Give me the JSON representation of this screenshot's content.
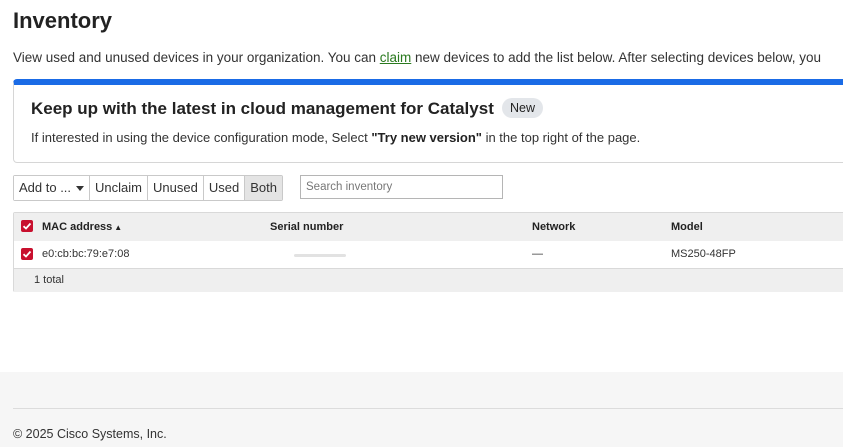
{
  "page": {
    "title": "Inventory",
    "intro_before": "View used and unused devices in your organization. You can ",
    "intro_link": "claim",
    "intro_after": " new devices to add the list below. After selecting devices below, you"
  },
  "banner": {
    "title": "Keep up with the latest in cloud management for Catalyst",
    "badge": "New",
    "text_before": "If interested in using the device configuration mode, Select ",
    "text_bold": "\"Try new version\"",
    "text_after": " in the top right of the page.",
    "accent_color": "#1a6be6"
  },
  "toolbar": {
    "add_to_label": "Add to ...",
    "unclaim_label": "Unclaim",
    "unused_label": "Unused",
    "used_label": "Used",
    "both_label": "Both",
    "active_filter": "Both"
  },
  "search": {
    "placeholder": "Search inventory",
    "value": ""
  },
  "table": {
    "columns": {
      "mac": "MAC address",
      "serial": "Serial number",
      "network": "Network",
      "model": "Model"
    },
    "sort_indicator": "▲",
    "rows": [
      {
        "selected": true,
        "mac": "e0:cb:bc:79:e7:08",
        "serial": "",
        "network": "—",
        "model": "MS250-48FP"
      }
    ],
    "total": "1 total",
    "checkbox_color": "#c8102e"
  },
  "footer": {
    "copyright": "© 2025 Cisco Systems, Inc."
  }
}
